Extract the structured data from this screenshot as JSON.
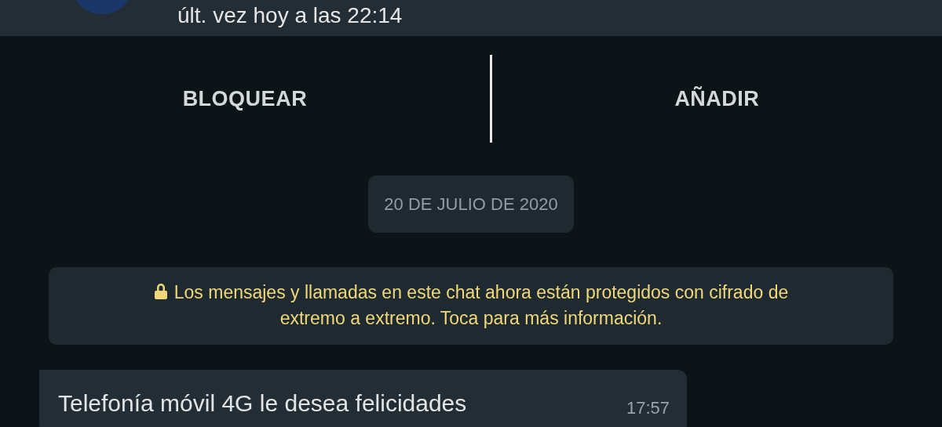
{
  "header": {
    "status": "últ. vez hoy a las 22:14"
  },
  "actions": [
    {
      "label": "BLOQUEAR"
    },
    {
      "label": "AÑADIR"
    }
  ],
  "date_chip": "20 DE JULIO DE 2020",
  "encryption_notice": "Los mensajes y llamadas en este chat ahora están protegidos con cifrado de extremo a extremo. Toca para más información.",
  "messages": [
    {
      "text": "Telefonía móvil 4G le desea felicidades",
      "time": "17:57",
      "incoming": true
    }
  ]
}
